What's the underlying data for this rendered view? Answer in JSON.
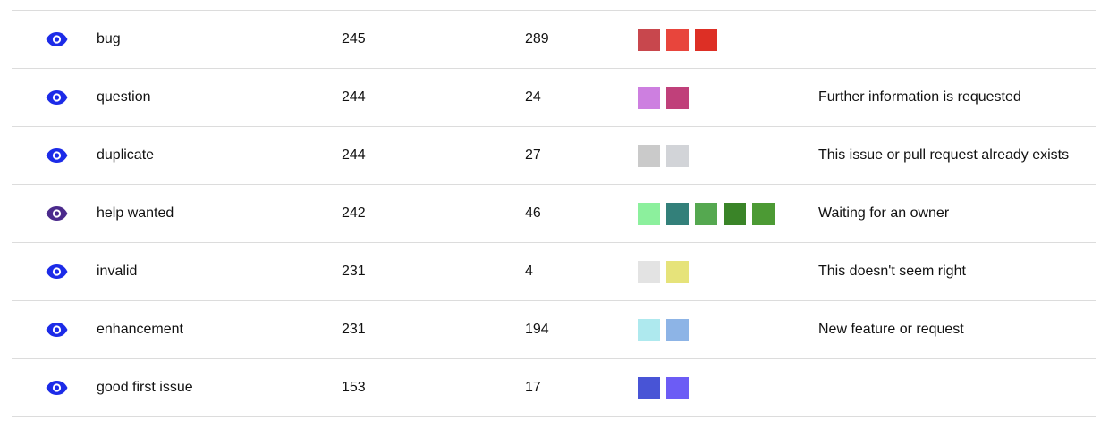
{
  "colors": {
    "eye_default": "#1c2be8",
    "eye_alt": "#4b2a8c",
    "row_border": "#dcdcdc"
  },
  "rows": [
    {
      "name": "bug",
      "count_a": "245",
      "count_b": "289",
      "eye_color": "#1c2be8",
      "swatches": [
        "#c8474d",
        "#e8453c",
        "#dd2f25"
      ],
      "description": ""
    },
    {
      "name": "question",
      "count_a": "244",
      "count_b": "24",
      "eye_color": "#1c2be8",
      "swatches": [
        "#cd7fe0",
        "#c0407a"
      ],
      "description": "Further information is requested"
    },
    {
      "name": "duplicate",
      "count_a": "244",
      "count_b": "27",
      "eye_color": "#1c2be8",
      "swatches": [
        "#cacaca",
        "#d2d4d8"
      ],
      "description": "This issue or pull request already exists"
    },
    {
      "name": "help wanted",
      "count_a": "242",
      "count_b": "46",
      "eye_color": "#4b2a8c",
      "swatches": [
        "#8cf09d",
        "#33807a",
        "#55a850",
        "#3a8428",
        "#4c9a34"
      ],
      "description": "Waiting for an owner"
    },
    {
      "name": "invalid",
      "count_a": "231",
      "count_b": "4",
      "eye_color": "#1c2be8",
      "swatches": [
        "#e3e3e3",
        "#e6e37a"
      ],
      "description": "This doesn't seem right"
    },
    {
      "name": "enhancement",
      "count_a": "231",
      "count_b": "194",
      "eye_color": "#1c2be8",
      "swatches": [
        "#aee9ee",
        "#8db4e6"
      ],
      "description": "New feature or request"
    },
    {
      "name": "good first issue",
      "count_a": "153",
      "count_b": "17",
      "eye_color": "#1c2be8",
      "swatches": [
        "#4854d6",
        "#6c5cf5"
      ],
      "description": ""
    }
  ]
}
